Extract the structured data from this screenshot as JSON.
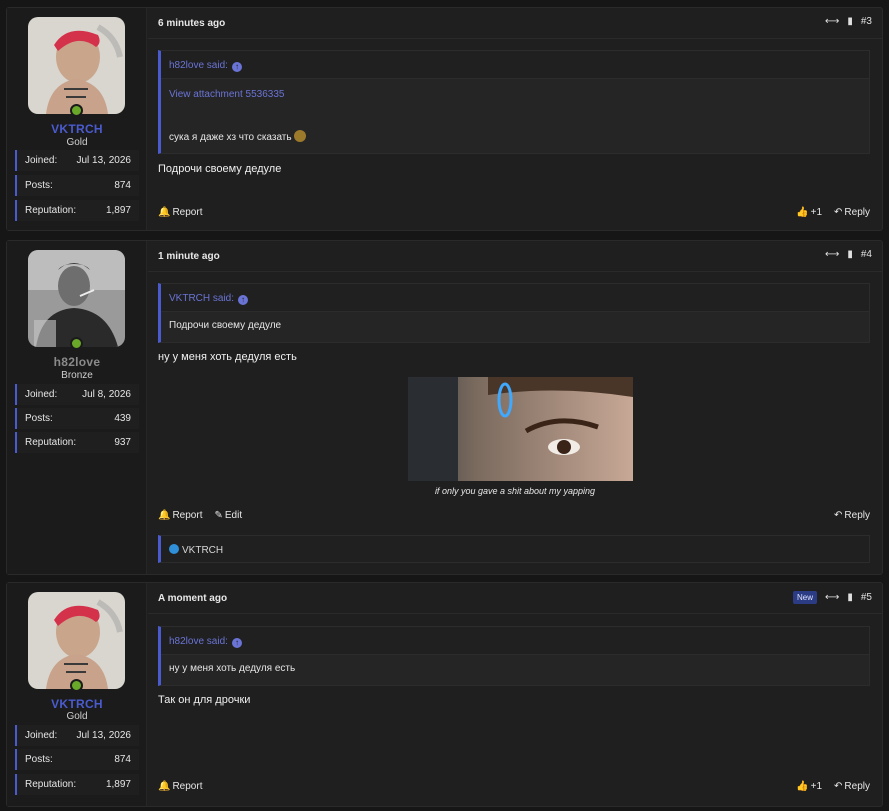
{
  "colors": {
    "accent": "#4a5bd0",
    "online": "#6aa82a",
    "vktrch_name": "#4a5bd0",
    "h82_name": "#8a8a8a"
  },
  "posts": [
    {
      "time": "6 minutes ago",
      "number": "#3",
      "user": {
        "name": "VKTRCH",
        "rank": "Gold",
        "joined_label": "Joined:",
        "joined": "Jul 13, 2026",
        "posts_label": "Posts:",
        "posts": "874",
        "rep_label": "Reputation:",
        "reputation": "1,897"
      },
      "quote": {
        "author": "h82love said:",
        "attachment": "View attachment 5536335",
        "text": "сука я даже хз что сказать"
      },
      "body": "Подрочи своему дедуле",
      "report": "Report",
      "like_count": "+1",
      "reply": "Reply"
    },
    {
      "time": "1 minute ago",
      "number": "#4",
      "user": {
        "name": "h82love",
        "rank": "Bronze",
        "joined_label": "Joined:",
        "joined": "Jul 8, 2026",
        "posts_label": "Posts:",
        "posts": "439",
        "rep_label": "Reputation:",
        "reputation": "937"
      },
      "quote": {
        "author": "VKTRCH said:",
        "text": "Подрочи своему дедуле"
      },
      "body": "ну у меня хоть дедуля есть",
      "caption": "if only you gave a shit about my yapping",
      "report": "Report",
      "edit": "Edit",
      "reply": "Reply",
      "reaction_user": "VKTRCH"
    },
    {
      "time": "A moment ago",
      "new_badge": "New",
      "number": "#5",
      "user": {
        "name": "VKTRCH",
        "rank": "Gold",
        "joined_label": "Joined:",
        "joined": "Jul 13, 2026",
        "posts_label": "Posts:",
        "posts": "874",
        "rep_label": "Reputation:",
        "reputation": "1,897"
      },
      "quote": {
        "author": "h82love said:",
        "text": "ну у меня хоть дедуля есть"
      },
      "body": "Так он для дрочки",
      "report": "Report",
      "like_count": "+1",
      "reply": "Reply"
    }
  ]
}
